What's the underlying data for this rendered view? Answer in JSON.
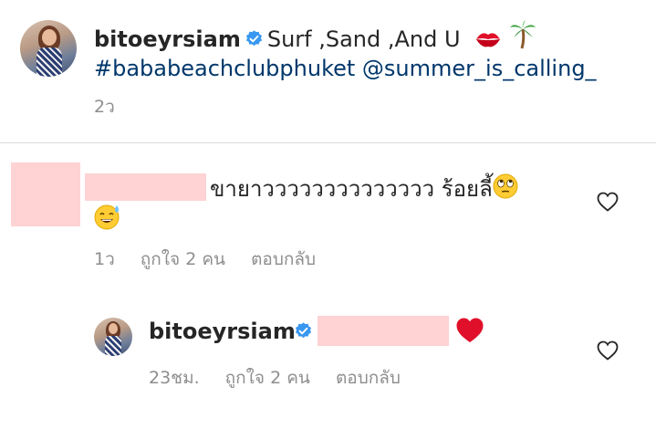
{
  "post": {
    "username": "bitoeyrsiam",
    "caption_text": "Surf ,Sand ,And U",
    "hashtag_line": "#bababeachclubphuket @summer_is_calling_",
    "time": "2ว",
    "emojis": [
      "kiss-mark-emoji",
      "palm-tree-emoji"
    ]
  },
  "comment": {
    "text": "ขายาวววววววววววววว ร้อยลี้",
    "time": "1ว",
    "likes_label": "ถูกใจ 2 คน",
    "reply_label": "ตอบกลับ",
    "emojis": [
      "eye-roll-emoji",
      "sweat-smile-emoji"
    ]
  },
  "reply": {
    "username": "bitoeyrsiam",
    "time": "23ชม.",
    "likes_label": "ถูกใจ 2 คน",
    "reply_label": "ตอบกลับ",
    "emojis": [
      "red-heart-emoji"
    ]
  },
  "colors": {
    "verified_blue": "#3897f0",
    "link_blue": "#00376b",
    "meta_gray": "#8e8e8e",
    "redaction_pink": "#ffd2d4",
    "heart_red": "#e0102a"
  }
}
